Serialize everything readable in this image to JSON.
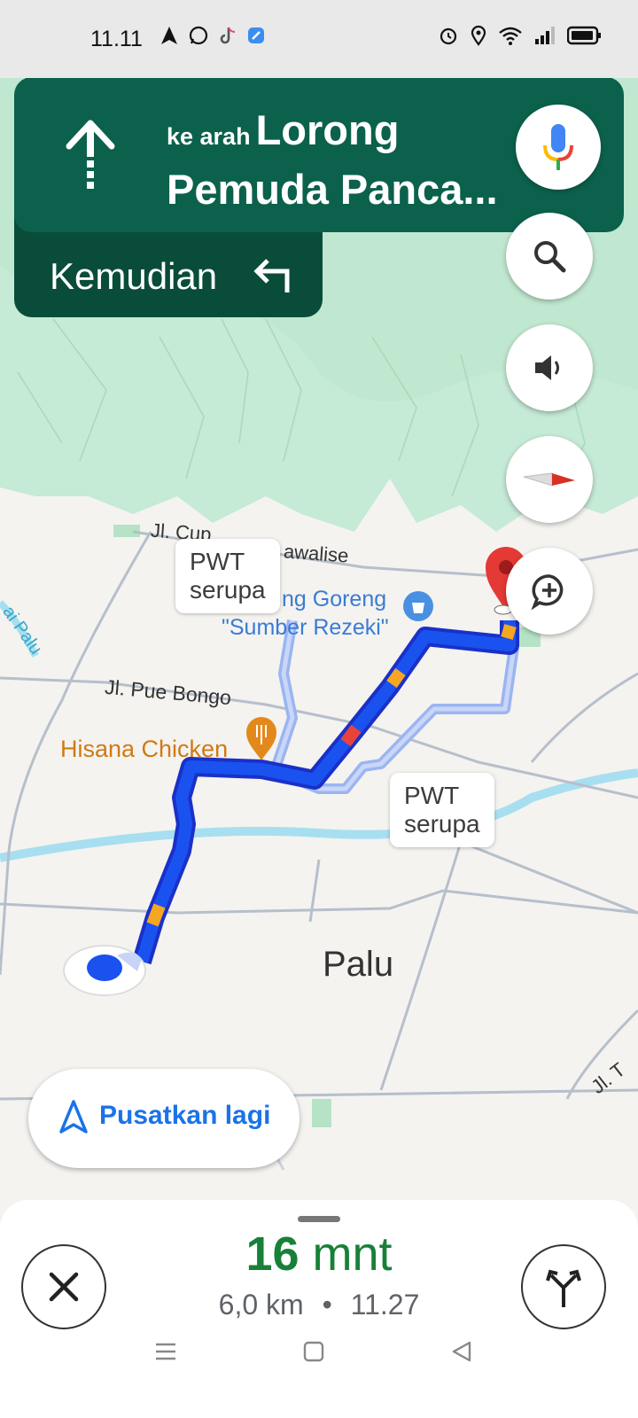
{
  "status_bar": {
    "time": "11.11"
  },
  "navigation": {
    "prefix": "ke arah",
    "street_line1": "Lorong",
    "street_line2": "Pemuda Panca...",
    "then_label": "Kemudian"
  },
  "map": {
    "labels": {
      "road_cup": "Jl. Cup",
      "road_awalise": "awalise",
      "road_pue_bongo": "Jl. Pue Bongo",
      "poi_shop_line1": "ng Goreng",
      "poi_shop_line2": "\"Sumber Rezeki\"",
      "poi_hisana": "Hisana Chicken",
      "city": "Palu",
      "river_left": "ai Palu",
      "road_right": "Jl. T"
    },
    "alt_route_bubble_1": {
      "line1": "PWT",
      "line2": "serupa"
    },
    "alt_route_bubble_2": {
      "line1": "PWT",
      "line2": "serupa"
    }
  },
  "controls": {
    "recenter_label": "Pusatkan lagi"
  },
  "trip": {
    "eta_value": "16",
    "eta_unit": "mnt",
    "distance": "6,0 km",
    "separator": "•",
    "arrival": "11.27"
  },
  "colors": {
    "nav_green": "#0b614c",
    "route_blue": "#1a44e8",
    "eta_green": "#188038"
  }
}
